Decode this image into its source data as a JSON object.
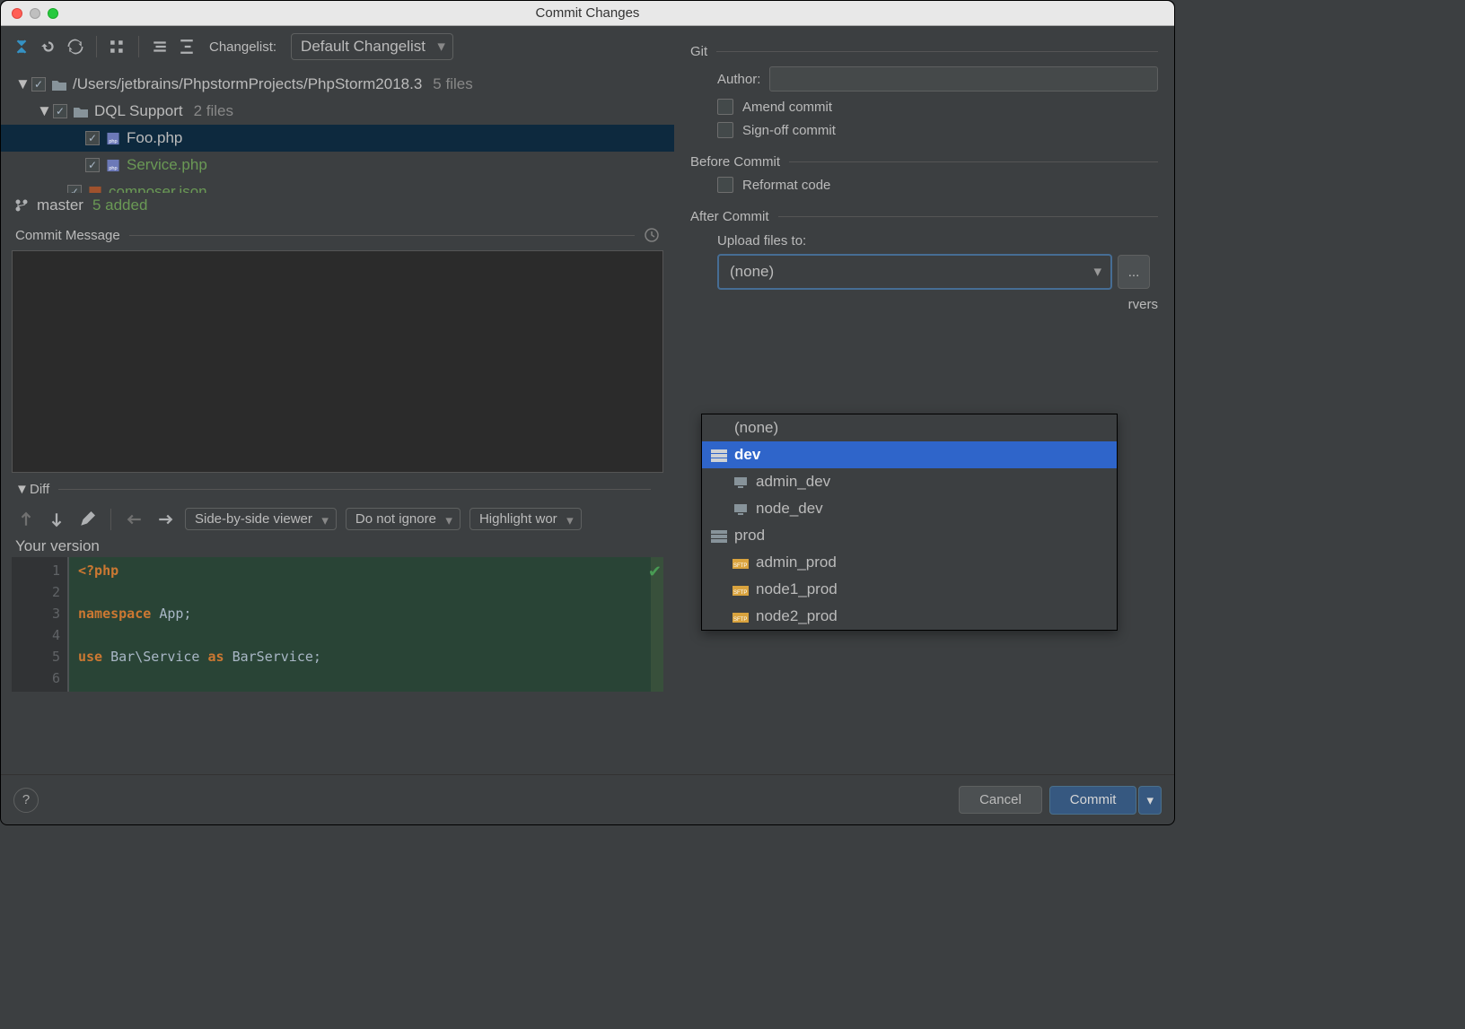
{
  "window_title": "Commit Changes",
  "toolbar": {
    "changelist_label": "Changelist:",
    "changelist_value": "Default Changelist"
  },
  "tree": {
    "root": {
      "path": "/Users/jetbrains/PhpstormProjects/PhpStorm2018.3",
      "count": "5 files"
    },
    "folder1": {
      "name": "DQL Support",
      "count": "2 files"
    },
    "files": [
      "Foo.php",
      "Service.php",
      "composer.json"
    ]
  },
  "branch": {
    "name": "master",
    "status": "5 added"
  },
  "commit_message_label": "Commit Message",
  "diff_section_label": "Diff",
  "diff": {
    "viewer_mode": "Side-by-side viewer",
    "ignore_mode": "Do not ignore",
    "highlight_mode": "Highlight wor",
    "your_version": "Your version",
    "lines": [
      "1",
      "2",
      "3",
      "4",
      "5",
      "6"
    ]
  },
  "right": {
    "git_label": "Git",
    "author_label": "Author:",
    "amend_label": "Amend commit",
    "signoff_label": "Sign-off commit",
    "before_commit_label": "Before Commit",
    "reformat_label": "Reformat code",
    "after_commit_label": "After Commit",
    "upload_label": "Upload files to:",
    "upload_value": "(none)",
    "servers_hint": "rvers"
  },
  "dropdown": {
    "items": [
      {
        "label": "(none)",
        "indent": 0,
        "icon": null,
        "selected": false
      },
      {
        "label": "dev",
        "indent": 0,
        "icon": "group",
        "selected": true
      },
      {
        "label": "admin_dev",
        "indent": 1,
        "icon": "server",
        "selected": false
      },
      {
        "label": "node_dev",
        "indent": 1,
        "icon": "server",
        "selected": false
      },
      {
        "label": "prod",
        "indent": 0,
        "icon": "group",
        "selected": false
      },
      {
        "label": "admin_prod",
        "indent": 1,
        "icon": "sftp",
        "selected": false
      },
      {
        "label": "node1_prod",
        "indent": 1,
        "icon": "sftp",
        "selected": false
      },
      {
        "label": "node2_prod",
        "indent": 1,
        "icon": "sftp",
        "selected": false
      }
    ]
  },
  "footer": {
    "cancel": "Cancel",
    "commit": "Commit"
  }
}
